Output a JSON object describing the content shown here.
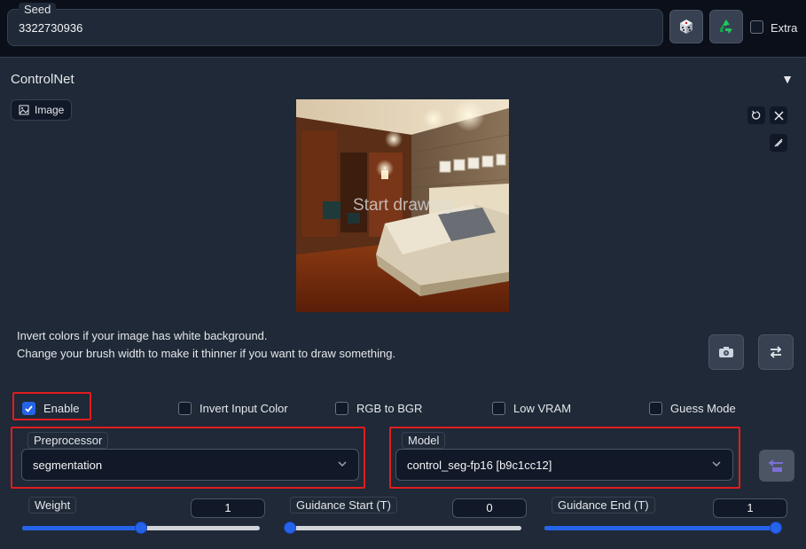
{
  "seed": {
    "label": "Seed",
    "value": "3322730936",
    "extra_label": "Extra"
  },
  "controlnet": {
    "title": "ControlNet",
    "image_tab_label": "Image",
    "canvas_overlay": "Start drawing",
    "hint_line1": "Invert colors if your image has white background.",
    "hint_line2": "Change your brush width to make it thinner if you want to draw something.",
    "checkboxes": {
      "enable": {
        "label": "Enable",
        "checked": true
      },
      "invert_input_color": {
        "label": "Invert Input Color",
        "checked": false
      },
      "rgb_to_bgr": {
        "label": "RGB to BGR",
        "checked": false
      },
      "low_vram": {
        "label": "Low VRAM",
        "checked": false
      },
      "guess_mode": {
        "label": "Guess Mode",
        "checked": false
      }
    },
    "preprocessor": {
      "label": "Preprocessor",
      "value": "segmentation"
    },
    "model": {
      "label": "Model",
      "value": "control_seg-fp16 [b9c1cc12]"
    },
    "weight": {
      "label": "Weight",
      "value": "1",
      "fraction": 0.5
    },
    "guidance_start": {
      "label": "Guidance Start (T)",
      "value": "0",
      "fraction": 0.0
    },
    "guidance_end": {
      "label": "Guidance End (T)",
      "value": "1",
      "fraction": 1.0
    }
  },
  "colors": {
    "accent": "#2563eb",
    "highlight": "#e11d1d",
    "panel": "#1f2937",
    "background": "#0b0f19"
  }
}
